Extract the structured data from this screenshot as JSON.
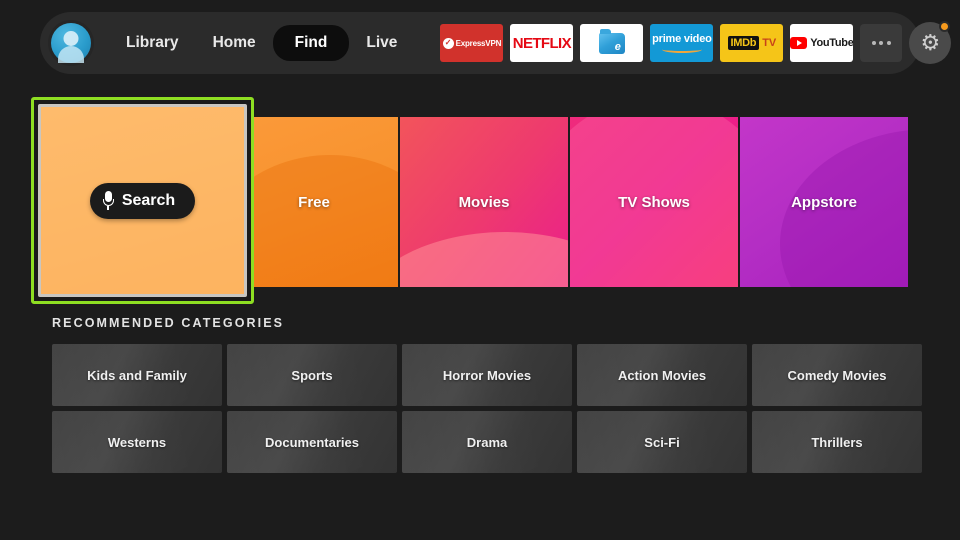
{
  "nav": {
    "avatar_name": "profile-avatar",
    "links": [
      {
        "label": "Library",
        "active": false
      },
      {
        "label": "Home",
        "active": false
      },
      {
        "label": "Find",
        "active": true
      },
      {
        "label": "Live",
        "active": false
      }
    ],
    "apps": [
      {
        "name": "expressvpn",
        "label": "ExpressVPN"
      },
      {
        "name": "netflix",
        "label": "NETFLIX"
      },
      {
        "name": "es-file-explorer",
        "label": "ES File Explorer"
      },
      {
        "name": "prime-video",
        "label": "prime video"
      },
      {
        "name": "imdb-tv",
        "label_primary": "IMDb",
        "label_secondary": "TV"
      },
      {
        "name": "youtube",
        "label": "YouTube"
      }
    ],
    "more_label": "More apps",
    "settings_label": "Settings",
    "notification_visible": true
  },
  "tiles": [
    {
      "name": "search",
      "label": "Search",
      "focused": true,
      "color": "#fbaa50"
    },
    {
      "name": "free",
      "label": "Free",
      "focused": false,
      "color": "#f8932f"
    },
    {
      "name": "movies",
      "label": "Movies",
      "focused": false,
      "color": "#ee3a6e"
    },
    {
      "name": "tv-shows",
      "label": "TV Shows",
      "focused": false,
      "color": "#ec1f88"
    },
    {
      "name": "appstore",
      "label": "Appstore",
      "focused": false,
      "color": "#b42ec4"
    }
  ],
  "section": {
    "title": "RECOMMENDED CATEGORIES"
  },
  "categories": [
    {
      "label": "Kids and Family"
    },
    {
      "label": "Sports"
    },
    {
      "label": "Horror Movies"
    },
    {
      "label": "Action Movies"
    },
    {
      "label": "Comedy Movies"
    },
    {
      "label": "Westerns"
    },
    {
      "label": "Documentaries"
    },
    {
      "label": "Drama"
    },
    {
      "label": "Sci-Fi"
    },
    {
      "label": "Thrillers"
    }
  ],
  "colors": {
    "background": "#1c1c1c",
    "navbar": "#2b2b2b",
    "focus_border": "#8ede22",
    "notification": "#f79b1e"
  }
}
